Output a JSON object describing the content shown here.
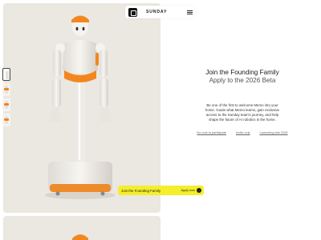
{
  "nav": {
    "brand": "SUNDAY",
    "logo_icon": "sunday-logo-icon",
    "menu_icon": "hamburger-menu-icon"
  },
  "gallery": {
    "thumbnails": [
      {
        "label": "robot-front-thumbnail",
        "active": true
      },
      {
        "label": "robot-side-thumbnail",
        "active": false
      },
      {
        "label": "robot-arms-thumbnail",
        "active": false
      },
      {
        "label": "robot-detail-thumbnail",
        "active": false
      }
    ]
  },
  "cta": {
    "label": "Join the Founding Family",
    "link": "Apply now",
    "arrow": "→",
    "color": "#f4ee2c"
  },
  "main": {
    "title": "Join the Founding Family",
    "subtitle": "Apply to the 2026 Beta",
    "description": "Be one of the first to welcome Memo into your home. Guide what Memo learns, gain exclusive access to the Sunday team's journey, and help shape the future of AI robotics in the home.",
    "links": [
      "No cost to participate",
      "Invite only",
      "Launching late 2026"
    ]
  },
  "colors": {
    "accent_orange": "#f5841f",
    "robot_white": "#f5f3ee",
    "panel_bg": "#ebe7e1"
  }
}
